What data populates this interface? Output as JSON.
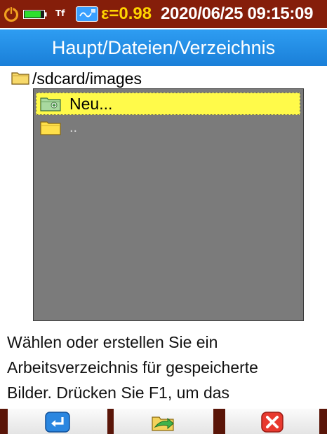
{
  "status_bar": {
    "tf_label": "Tf",
    "emissivity": "ε=0.98",
    "datetime": "2020/06/25 09:15:09",
    "icons": [
      "power-icon",
      "battery-icon",
      "sd-card-icon"
    ],
    "colors": {
      "background": "#851e0a",
      "emissivity_text": "#ffd400",
      "text": "#ffffff"
    }
  },
  "title_bar": {
    "title": "Haupt/Dateien/Verzeichnis",
    "color": "#1e88e5"
  },
  "current_path": {
    "icon": "folder-icon",
    "text": "/sdcard/images"
  },
  "file_list": {
    "items": [
      {
        "label": "Neu...",
        "icon": "new-folder-icon",
        "selected": true
      },
      {
        "label": "..",
        "icon": "folder-icon",
        "selected": false
      }
    ],
    "colors": {
      "background": "#7b7b7b",
      "selection": "#fffa4a"
    }
  },
  "help": {
    "lines": [
      "Wählen oder erstellen Sie ein",
      "Arbeitsverzeichnis für gespeicherte",
      "Bilder. Drücken Sie F1, um das"
    ]
  },
  "softkeys": [
    {
      "icon": "enter-icon"
    },
    {
      "icon": "open-folder-arrow-icon"
    },
    {
      "icon": "close-icon"
    }
  ]
}
